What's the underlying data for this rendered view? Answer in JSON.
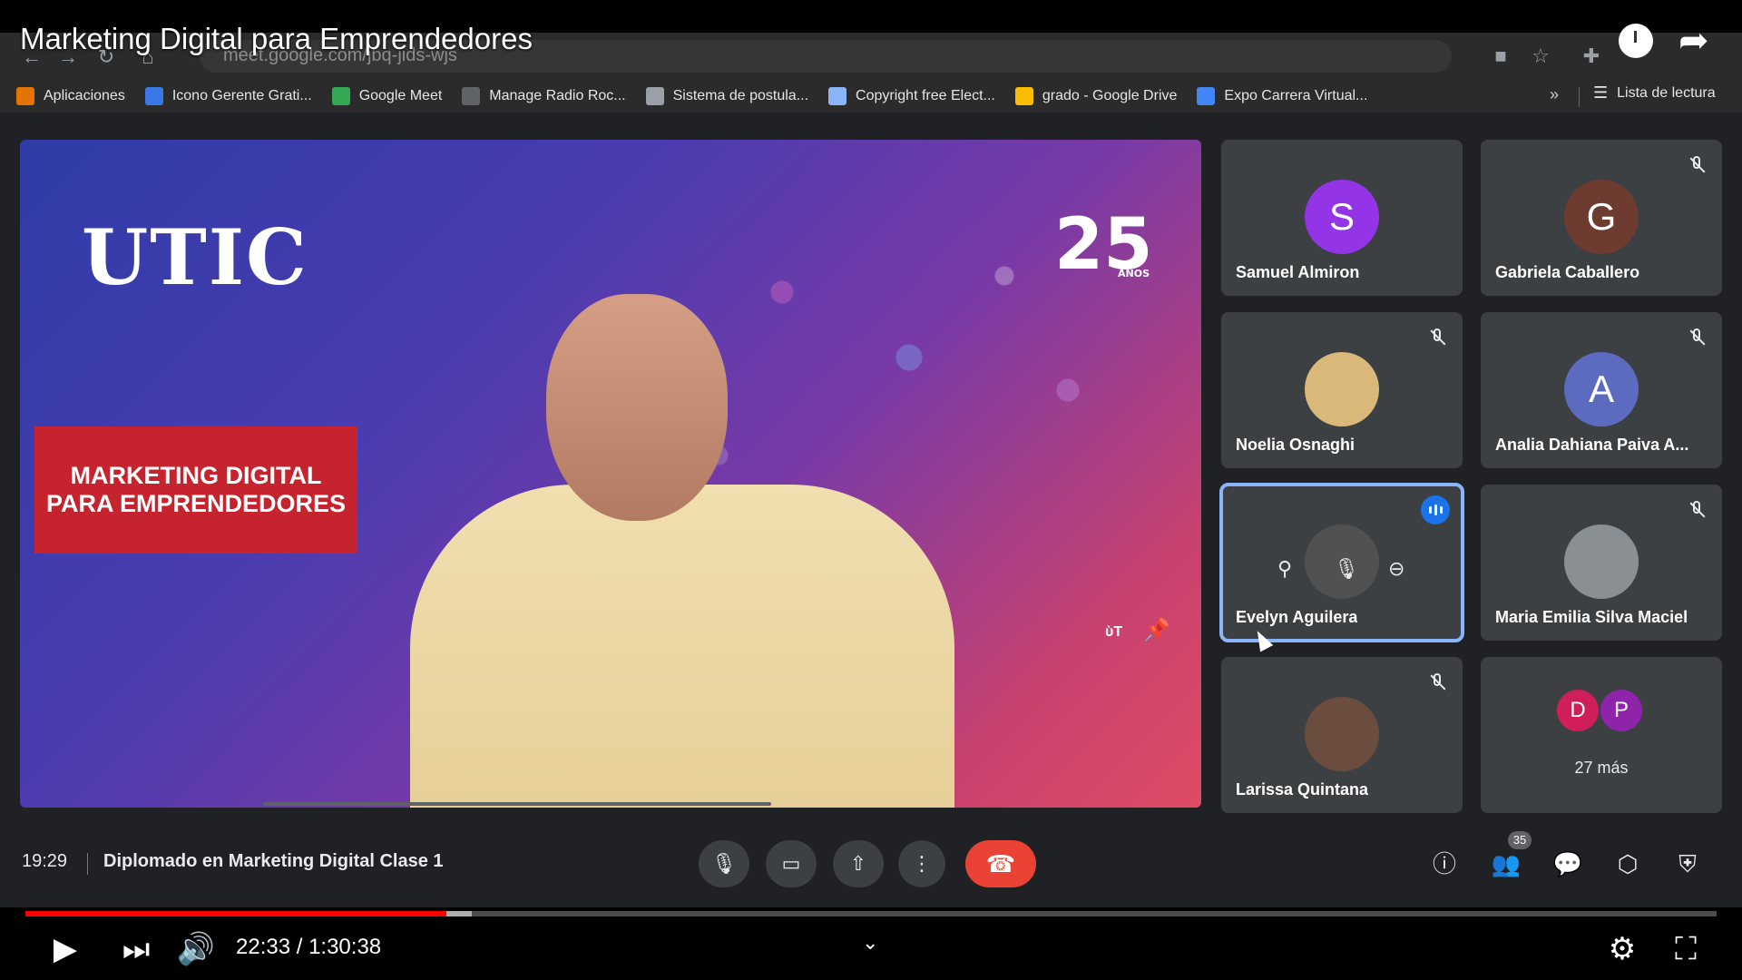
{
  "video": {
    "title": "Marketing Digital para Emprendedores"
  },
  "browser": {
    "url": "meet.google.com/jbq-jids-wjs",
    "bookmarks": [
      {
        "label": "Aplicaciones",
        "color": "#e37400"
      },
      {
        "label": "Icono Gerente Grati...",
        "color": "#3b78e7"
      },
      {
        "label": "Google Meet",
        "color": "#34a853"
      },
      {
        "label": "Manage Radio Roc...",
        "color": "#5f6368"
      },
      {
        "label": "Sistema de postula...",
        "color": "#9aa0a6"
      },
      {
        "label": "Copyright free Elect...",
        "color": "#8ab4f8"
      },
      {
        "label": "grado - Google Drive",
        "color": "#fbbc04"
      },
      {
        "label": "Expo Carrera Virtual...",
        "color": "#4285f4"
      }
    ],
    "more_label": "»",
    "reading_list": "Lista de lectura"
  },
  "presentation": {
    "logo_text": "UTIC",
    "anniversary_number": "25",
    "anniversary_text": "AÑOS",
    "banner_text": "MARKETING DIGITAL PARA EMPRENDEDORES"
  },
  "participants": [
    {
      "name": "Samuel Almiron",
      "initial": "S",
      "avatar_color": "#9334e6",
      "muted": false
    },
    {
      "name": "Gabriela Caballero",
      "initial": "G",
      "avatar_color": "#6d3b2f",
      "muted": true
    },
    {
      "name": "Noelia Osnaghi",
      "initial": "",
      "avatar_color": "#d9b87a",
      "muted": true
    },
    {
      "name": "Analia Dahiana Paiva A...",
      "initial": "A",
      "avatar_color": "#5c6bc0",
      "muted": true
    },
    {
      "name": "Evelyn Aguilera",
      "initial": "",
      "avatar_color": "#5f5f5f",
      "muted": false,
      "speaking": true
    },
    {
      "name": "Maria Emilia Silva Maciel",
      "initial": "",
      "avatar_color": "#8a8f94",
      "muted": true
    },
    {
      "name": "Larissa Quintana",
      "initial": "",
      "avatar_color": "#6b4d3f",
      "muted": true
    }
  ],
  "more_participants": {
    "initials": [
      "D",
      "P"
    ],
    "colors": [
      "#d01e5a",
      "#8e24aa"
    ],
    "label": "27 más"
  },
  "meeting": {
    "time": "19:29",
    "title": "Diplomado en Marketing Digital Clase 1",
    "participant_count": "35"
  },
  "player": {
    "current_time": "22:33",
    "duration": "1:30:38",
    "time_display": "22:33 / 1:30:38",
    "played_fraction": 0.249,
    "buffered_fraction": 0.264
  },
  "colors": {
    "meet_bg": "#202124",
    "tile_bg": "#3c4043",
    "end_call": "#ea4335",
    "active_outline": "#8ab4f8",
    "yt_progress": "#ff0000"
  }
}
